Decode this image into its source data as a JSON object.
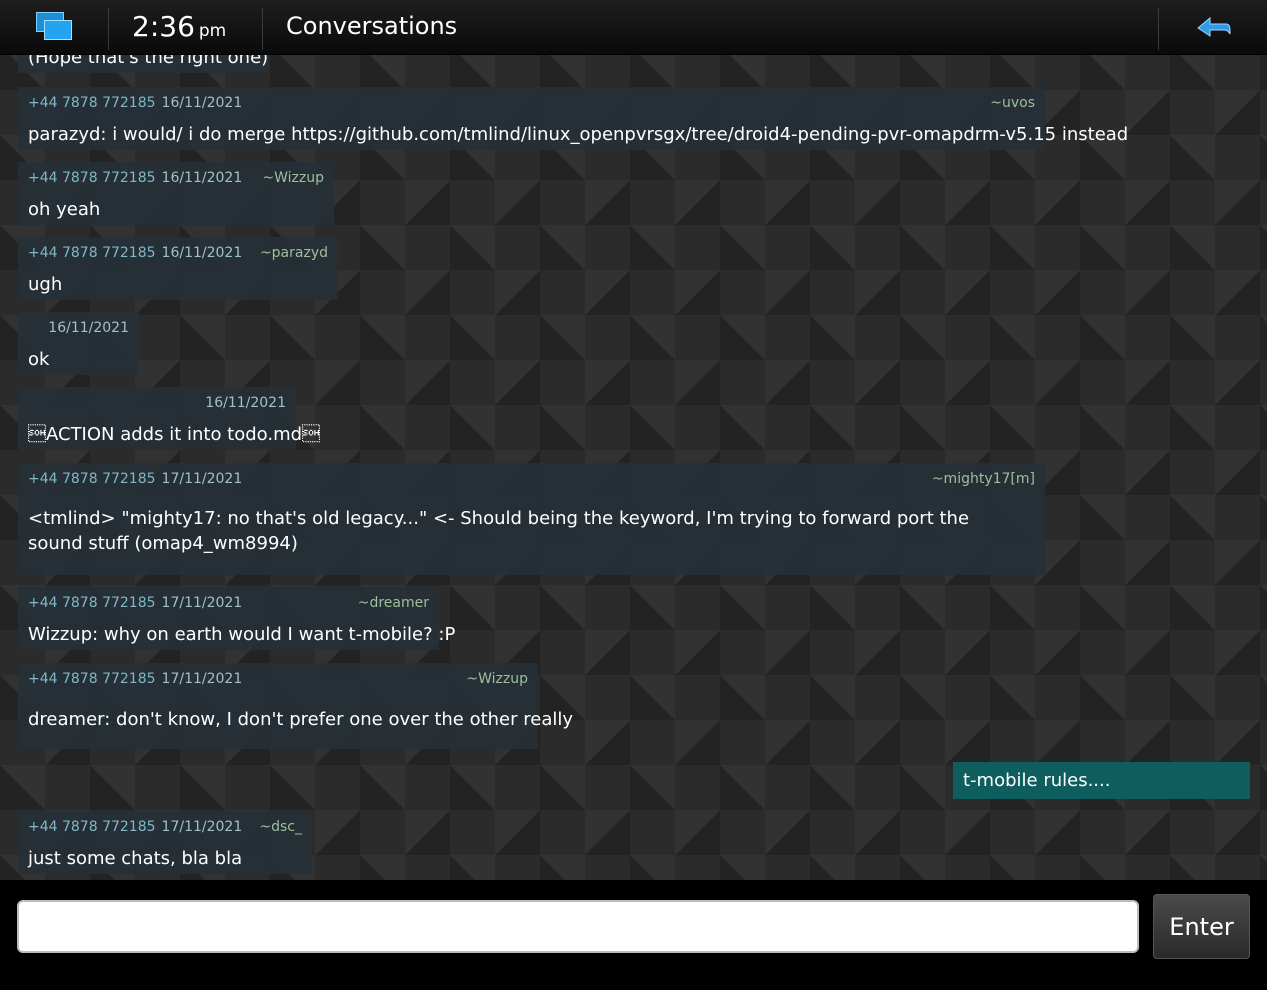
{
  "topbar": {
    "clock_time": "2:36",
    "clock_ampm": "pm",
    "title": "Conversations"
  },
  "partial_message": {
    "body": "(Hope that's the right one)"
  },
  "messages": [
    {
      "number": "+44 7878 772185",
      "date": "16/11/2021",
      "nick": "~uvos",
      "body": "parazyd: i would/ i do merge https://github.com/tmlind/linux_openpvrsgx/tree/droid4-pending-pvr-omapdrm-v5.15 instead"
    },
    {
      "number": "+44 7878 772185",
      "date": "16/11/2021",
      "nick": "~Wizzup",
      "body": "oh yeah"
    },
    {
      "number": "+44 7878 772185",
      "date": "16/11/2021",
      "nick": "~parazyd",
      "body": "ugh"
    },
    {
      "number": "",
      "date": "16/11/2021",
      "nick": "",
      "body": "ok"
    },
    {
      "number": "",
      "date": "16/11/2021",
      "nick": "",
      "body": "\u0001ACTION adds it into todo.md\u0001"
    },
    {
      "number": "+44 7878 772185",
      "date": "17/11/2021",
      "nick": "~mighty17[m]",
      "body": "<tmlind> \"mighty17: no that's old legacy...\" <- Should being the keyword, I'm trying to forward port the sound stuff (omap4_wm8994)"
    },
    {
      "number": "+44 7878 772185",
      "date": "17/11/2021",
      "nick": "~dreamer",
      "body": "Wizzup: why on earth would I want t-mobile? :P"
    },
    {
      "number": "+44 7878 772185",
      "date": "17/11/2021",
      "nick": "~Wizzup",
      "body": "dreamer: don't know, I don't prefer one over the other really"
    },
    {
      "number": "+44 7878 772185",
      "date": "17/11/2021",
      "nick": "~dsc_",
      "body": "just some chats, bla bla"
    }
  ],
  "own_message": {
    "body": "t-mobile rules...."
  },
  "composer": {
    "value": "",
    "enter_label": "Enter"
  },
  "colors": {
    "own_bubble": "#0d5e5d",
    "bubble": "#263036",
    "accent_blue": "#1c8fd8"
  }
}
